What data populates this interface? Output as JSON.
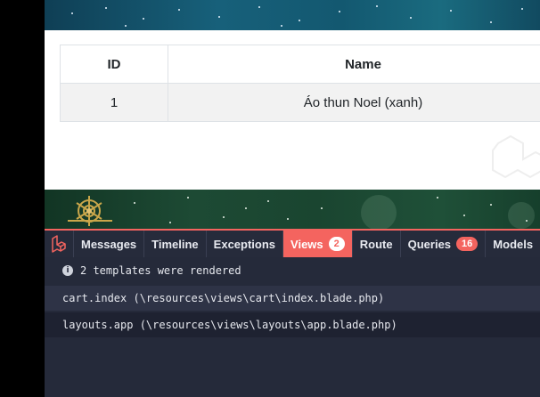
{
  "table": {
    "headers": [
      "ID",
      "Name"
    ],
    "rows": [
      {
        "id": "1",
        "name": "Áo thun Noel (xanh)"
      }
    ]
  },
  "debugbar": {
    "tabs": [
      {
        "label": "Messages"
      },
      {
        "label": "Timeline"
      },
      {
        "label": "Exceptions"
      },
      {
        "label": "Views",
        "badge": "2",
        "active": true
      },
      {
        "label": "Route"
      },
      {
        "label": "Queries",
        "badge": "16"
      },
      {
        "label": "Models"
      }
    ],
    "status": "2 templates were rendered",
    "views": [
      "cart.index (\\resources\\views\\cart\\index.blade.php)",
      "layouts.app (\\resources\\views\\layouts\\app.blade.php)"
    ]
  },
  "colors": {
    "accent": "#f4645f",
    "debugbar_bg": "#252a3a"
  },
  "icons": {
    "logo": "laravel-logo-icon",
    "info": "info-icon"
  }
}
